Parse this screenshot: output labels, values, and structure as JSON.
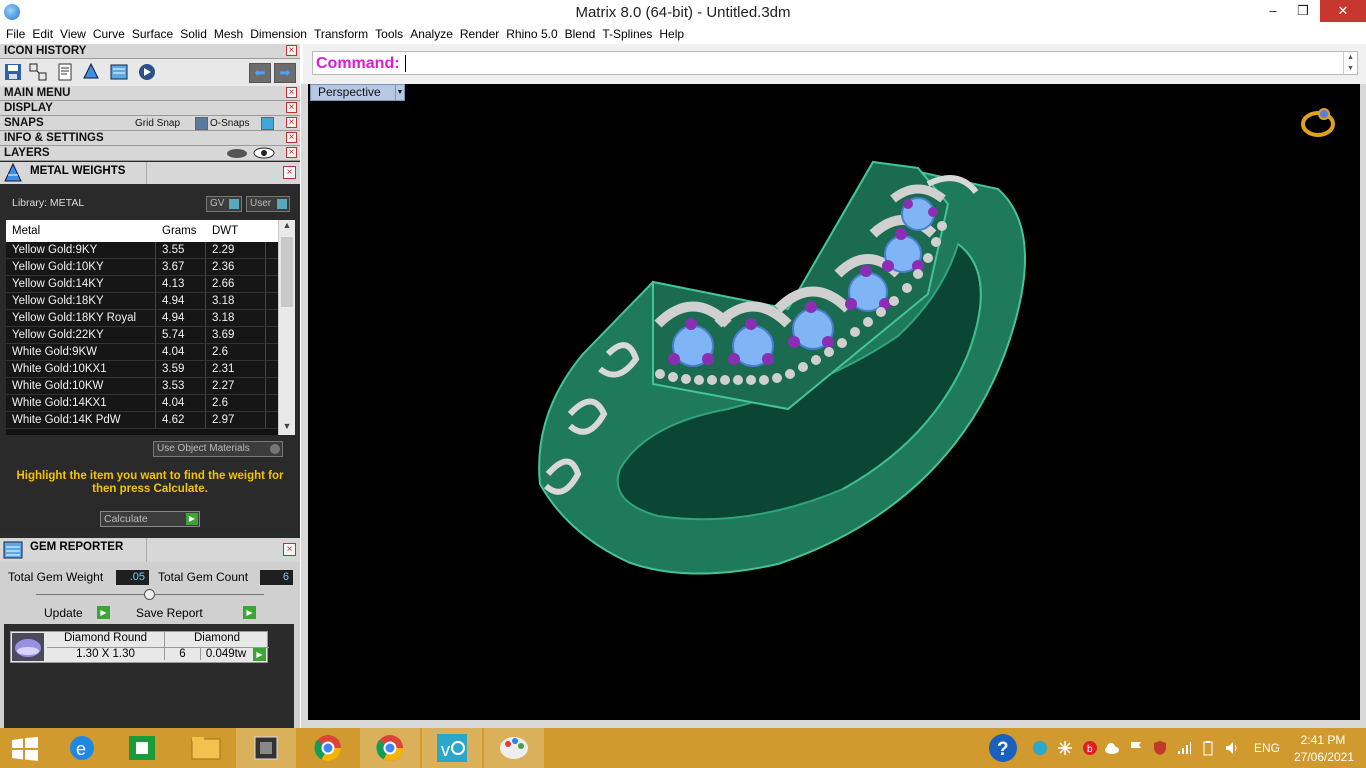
{
  "window": {
    "title": "Matrix 8.0 (64-bit) - Untitled.3dm",
    "minimize": "–",
    "restore": "❒",
    "close": "✕"
  },
  "menu": [
    "File",
    "Edit",
    "View",
    "Curve",
    "Surface",
    "Solid",
    "Mesh",
    "Dimension",
    "Transform",
    "Tools",
    "Analyze",
    "Render",
    "Rhino 5.0",
    "Blend",
    "T-Splines",
    "Help"
  ],
  "panels": {
    "icon_history": "ICON HISTORY",
    "main_menu": "MAIN MENU",
    "display": "DISPLAY",
    "snaps": "SNAPS",
    "grid_snap": "Grid Snap",
    "o_snaps": "O-Snaps",
    "info_settings": "INFO & SETTINGS",
    "layers": "LAYERS"
  },
  "metal_weights": {
    "title": "METAL WEIGHTS",
    "library": "Library: METAL",
    "gv_button": "GV",
    "user_button": "User",
    "columns": [
      "Metal",
      "Grams",
      "DWT"
    ],
    "rows": [
      [
        "Yellow Gold:9KY",
        "3.55",
        "2.29"
      ],
      [
        "Yellow Gold:10KY",
        "3.67",
        "2.36"
      ],
      [
        "Yellow Gold:14KY",
        "4.13",
        "2.66"
      ],
      [
        "Yellow Gold:18KY",
        "4.94",
        "3.18"
      ],
      [
        "Yellow Gold:18KY Royal",
        "4.94",
        "3.18"
      ],
      [
        "Yellow Gold:22KY",
        "5.74",
        "3.69"
      ],
      [
        "White Gold:9KW",
        "4.04",
        "2.6"
      ],
      [
        "White Gold:10KX1",
        "3.59",
        "2.31"
      ],
      [
        "White Gold:10KW",
        "3.53",
        "2.27"
      ],
      [
        "White Gold:14KX1",
        "4.04",
        "2.6"
      ],
      [
        "White Gold:14K PdW",
        "4.62",
        "2.97"
      ]
    ],
    "use_object_materials": "Use Object Materials",
    "hint": "Highlight the item you want to find the weight for then press Calculate.",
    "calculate": "Calculate"
  },
  "gem_reporter": {
    "title": "GEM REPORTER",
    "total_gem_weight_label": "Total Gem Weight",
    "total_gem_weight": ".05",
    "total_gem_count_label": "Total Gem Count",
    "total_gem_count": "6",
    "update": "Update",
    "save_report": "Save Report",
    "gem_shape": "Diamond Round",
    "gem_size": "1.30 X 1.30",
    "gem_type": "Diamond",
    "gem_count": "6",
    "gem_weight": "0.049tw"
  },
  "command": {
    "label": "Command:",
    "value": ""
  },
  "viewport": {
    "name": "Perspective"
  },
  "taskbar": {
    "language": "ENG",
    "time": "2:41 PM",
    "date": "27/06/2021"
  },
  "colors": {
    "ring_green": "#1f7a5c",
    "metal_silver": "#cfcfcf",
    "stone_blue": "#7fb4f5",
    "accent_purple": "#8a2fb5",
    "taskbar": "#d19a2e",
    "command_label": "#e01ad6"
  }
}
